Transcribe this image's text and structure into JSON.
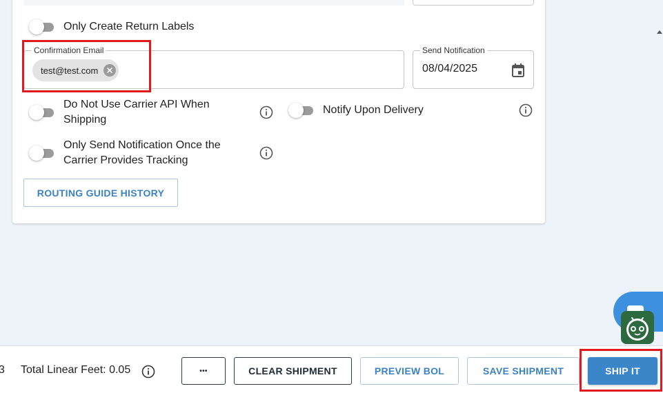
{
  "toggles": {
    "return_labels": "Only Create Return Labels",
    "no_carrier_api": "Do Not Use Carrier API When Shipping",
    "notify_delivery": "Notify Upon Delivery",
    "notify_tracking": "Only Send Notification Once the Carrier Provides Tracking"
  },
  "confirmation_email": {
    "label": "Confirmation Email",
    "chip": "test@test.com"
  },
  "send_notification": {
    "label": "Send Notification",
    "value": "08/04/2025"
  },
  "routing_guide_history": "ROUTING GUIDE HISTORY",
  "footer": {
    "edge_fragment": "3",
    "total_linear_feet": "Total Linear Feet: 0.05",
    "more": "•••",
    "clear_shipment": "CLEAR SHIPMENT",
    "preview_bol": "PREVIEW BOL",
    "save_shipment": "SAVE SHIPMENT",
    "ship_it": "SHIP IT"
  },
  "icons": [
    "info-icon",
    "calendar-icon",
    "close-icon",
    "chat-icon",
    "bot-icon"
  ],
  "colors": {
    "accent": "#3b86c8",
    "highlight": "#e0191e",
    "background": "#eef2f9"
  }
}
